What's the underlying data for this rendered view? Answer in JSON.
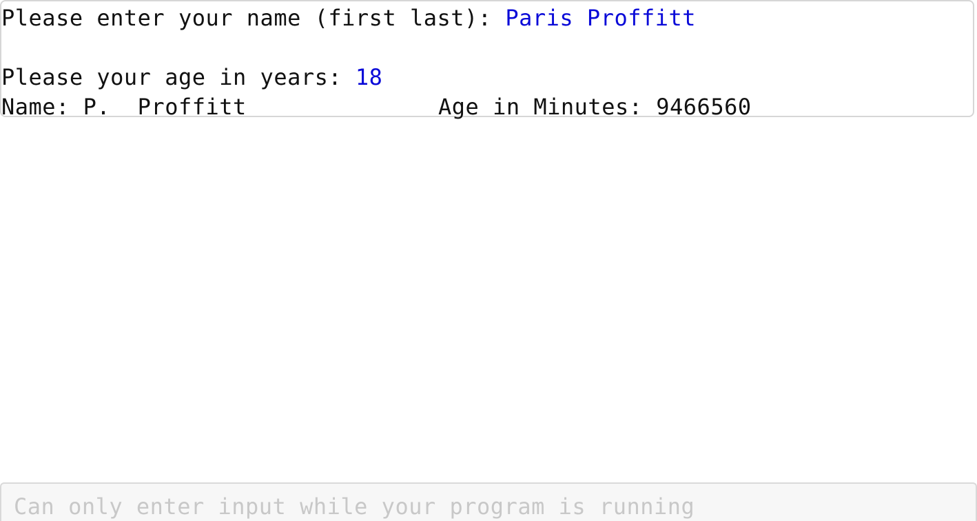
{
  "console": {
    "lines": [
      {
        "prompt": "Please enter your name (first last): ",
        "input": "Paris Proffitt"
      },
      {
        "prompt": "Please your age in years: ",
        "input": "18"
      }
    ],
    "result": {
      "name_text": "Name: P.  Proffitt",
      "age_text": "Age in Minutes: 9466560"
    }
  },
  "input_bar": {
    "placeholder": "Can only enter input while your program is running"
  },
  "colors": {
    "user_input": "#0a0ad8",
    "placeholder": "#c8c8c8"
  }
}
